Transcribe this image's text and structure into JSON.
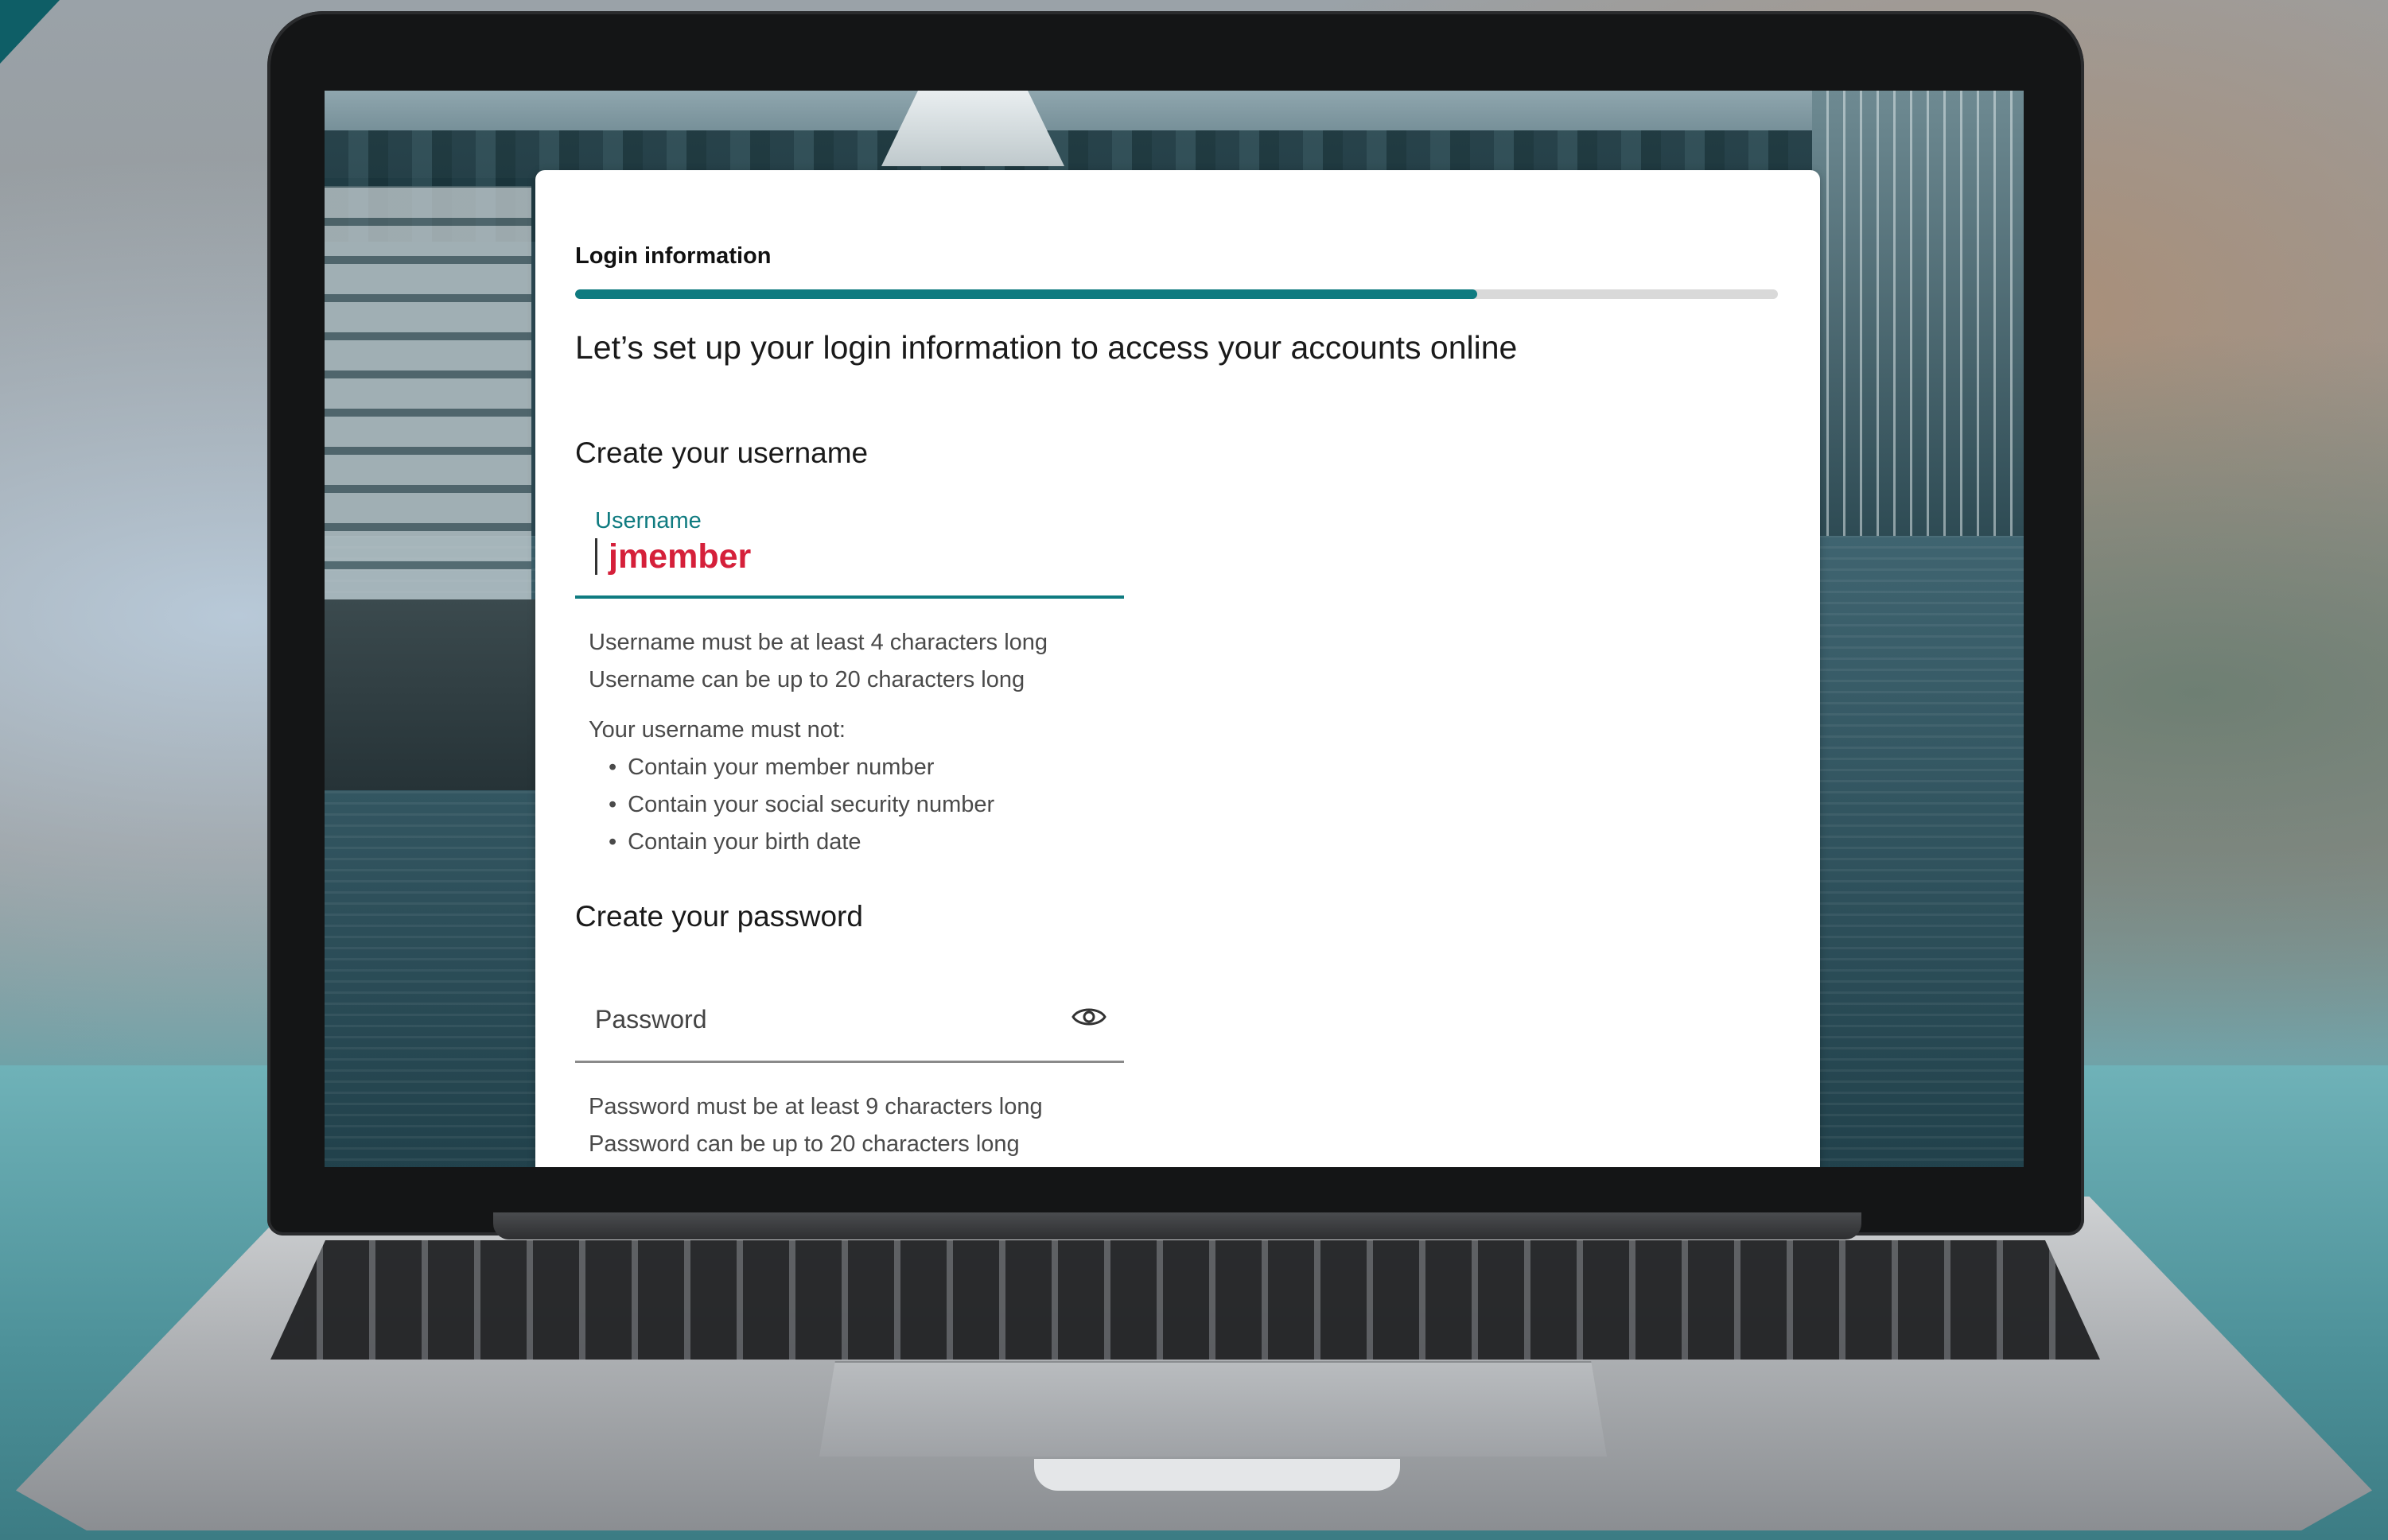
{
  "form": {
    "step_title": "Login information",
    "progress": 0.75,
    "lead": "Let’s set up your login information to access your accounts online",
    "username_section": "Create your username",
    "username_label": "Username",
    "username_value": "jmember",
    "username_rules": [
      "Username must be at least 4 characters long",
      "Username can be up to 20 characters long"
    ],
    "must_not_heading": "Your username must not:",
    "must_not": [
      "Contain your member number",
      "Contain your social security number",
      "Contain your birth date"
    ],
    "password_section": "Create your password",
    "password_placeholder": "Password",
    "password_rules": [
      "Password must be at least 9 characters long",
      "Password can be up to 20 characters long"
    ]
  },
  "colors": {
    "accent": "#0f7b80",
    "username_value": "#d5203a"
  },
  "icons": {
    "password_toggle": "eye-icon"
  }
}
